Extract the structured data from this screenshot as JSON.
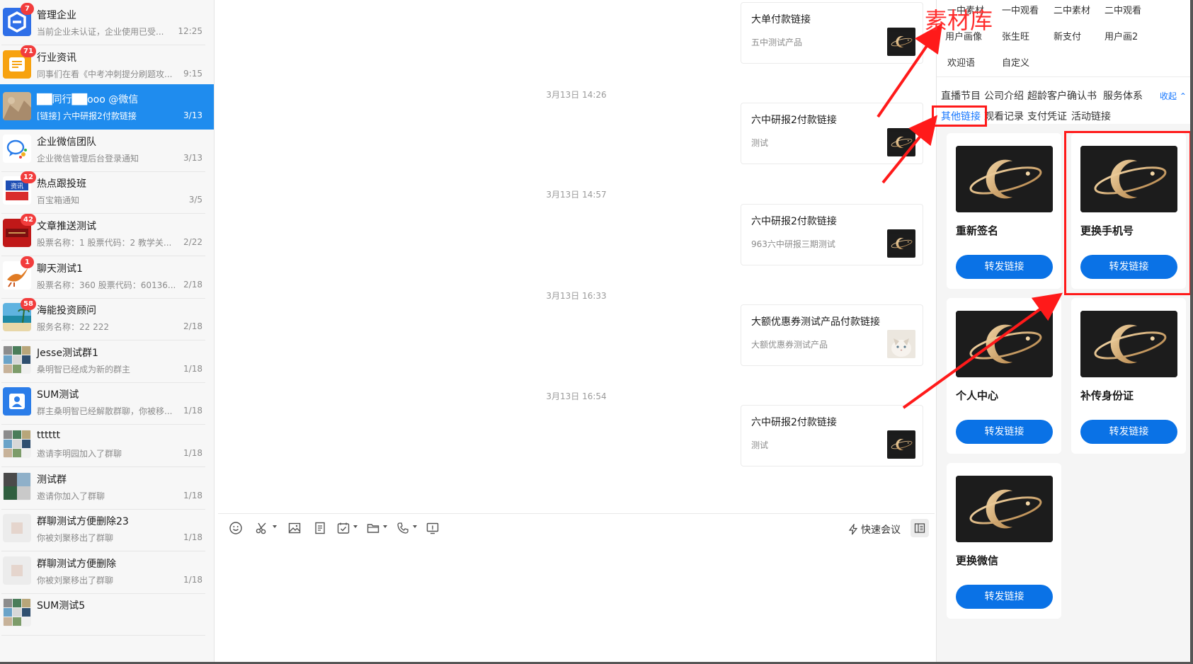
{
  "conversations": [
    {
      "name": "管理企业",
      "preview": "当前企业未认证，企业使用已受...",
      "time": "12:25",
      "badge": "7",
      "avatar": "logo-blue"
    },
    {
      "name": "行业资讯",
      "preview": "同事们在看《中考冲刺提分刷题攻...",
      "time": "9:15",
      "badge": "71",
      "avatar": "news-orange"
    },
    {
      "name": "██同行██ooo @微信",
      "preview": "[链接] 六中研报2付款链接",
      "time": "3/13",
      "badge": "",
      "avatar": "photo-beige",
      "active": true
    },
    {
      "name": "企业微信团队",
      "preview": "企业微信管理后台登录通知",
      "time": "3/13",
      "badge": "",
      "avatar": "wecom"
    },
    {
      "name": "热点跟投班",
      "preview": "百宝箱通知",
      "time": "3/5",
      "badge": "12",
      "avatar": "news-blue"
    },
    {
      "name": "文章推送测试",
      "preview": "股票名称：1 股票代码：2 教学关...",
      "time": "2/22",
      "badge": "42",
      "avatar": "red-banner"
    },
    {
      "name": "聊天测试1",
      "preview": "股票名称：360 股票代码：60136...",
      "time": "2/18",
      "badge": "1",
      "avatar": "phoenix"
    },
    {
      "name": "海能投资顾问",
      "preview": "服务名称：22  222",
      "time": "2/18",
      "badge": "58",
      "avatar": "beach"
    },
    {
      "name": "Jesse测试群1",
      "preview": "桑明智已经成为新的群主",
      "time": "1/18",
      "badge": "",
      "avatar": "group-grid"
    },
    {
      "name": "SUM测试",
      "preview": "群主桑明智已经解散群聊，你被移...",
      "time": "1/18",
      "badge": "",
      "avatar": "default-user"
    },
    {
      "name": "tttttt",
      "preview": "邀请李明园加入了群聊",
      "time": "1/18",
      "badge": "",
      "avatar": "group-grid"
    },
    {
      "name": "测试群",
      "preview": "邀请你加入了群聊",
      "time": "1/18",
      "badge": "",
      "avatar": "group-grid2"
    },
    {
      "name": "群聊测试方便删除23",
      "preview": "你被刘聚移出了群聊",
      "time": "1/18",
      "badge": "",
      "avatar": "placeholder"
    },
    {
      "name": "群聊测试方便删除",
      "preview": "你被刘聚移出了群聊",
      "time": "1/18",
      "badge": "",
      "avatar": "placeholder"
    },
    {
      "name": "SUM测试5",
      "preview": "",
      "time": "",
      "badge": "",
      "avatar": "group-grid"
    }
  ],
  "chat": {
    "messages": [
      {
        "type": "card",
        "title": "大单付款链接",
        "desc": "五中测试产品",
        "thumb": "planet-logo"
      },
      {
        "type": "timestamp",
        "text": "3月13日 14:26"
      },
      {
        "type": "card",
        "title": "六中研报2付款链接",
        "desc": "测试",
        "thumb": "planet-logo"
      },
      {
        "type": "timestamp",
        "text": "3月13日 14:57"
      },
      {
        "type": "card",
        "title": "六中研报2付款链接",
        "desc": "963六中研报三期测试",
        "thumb": "planet-logo"
      },
      {
        "type": "timestamp",
        "text": "3月13日 16:33"
      },
      {
        "type": "card",
        "title": "大额优惠券测试产品付款链接",
        "desc": "大额优惠券测试产品",
        "thumb": "cat-photo"
      },
      {
        "type": "timestamp",
        "text": "3月13日 16:54"
      },
      {
        "type": "card",
        "title": "六中研报2付款链接",
        "desc": "测试",
        "thumb": "planet-logo"
      }
    ],
    "toolbar": {
      "icons": [
        "emoji-icon",
        "scissors-icon",
        "image-icon",
        "document-icon",
        "todo-icon",
        "folder-icon",
        "phone-icon",
        "screen-share-icon"
      ],
      "quick_meeting": "快速会议"
    }
  },
  "panel": {
    "tab_rows": [
      [
        "一中素材",
        "一中观看",
        "二中素材",
        "二中观看"
      ],
      [
        "用户画像",
        "张生旺",
        "新支付",
        "用户画2"
      ],
      [
        "欢迎语",
        "自定义"
      ]
    ],
    "categories_row1": [
      "直播节目",
      "公司介绍",
      "超龄客户确认书",
      "服务体系"
    ],
    "categories_row2": [
      "其他链接",
      "观看记录",
      "支付凭证",
      "活动链接"
    ],
    "active_category": "其他链接",
    "collapse_label": "收起",
    "materials": [
      {
        "title": "重新签名",
        "button": "转发链接"
      },
      {
        "title": "更换手机号",
        "button": "转发链接"
      },
      {
        "title": "个人中心",
        "button": "转发链接"
      },
      {
        "title": "补传身份证",
        "button": "转发链接"
      },
      {
        "title": "更换微信",
        "button": "转发链接"
      }
    ]
  },
  "annotation": {
    "label": "素材库",
    "color": "#ff1a1a"
  },
  "colors": {
    "accent": "#1f8cee",
    "button": "#0a72e6",
    "badge": "#f23c3c"
  }
}
